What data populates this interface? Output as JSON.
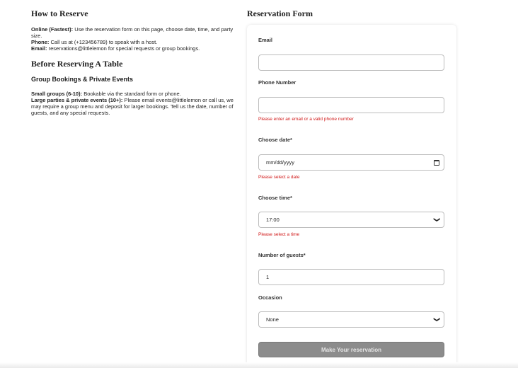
{
  "left": {
    "how_title": "How to Reserve",
    "online_label": "Online (Fastest):",
    "online_text": "Use the reservation form on this page, choose date, time, and party size.",
    "phone_label": "Phone:",
    "phone_text": "Call us at (+123456789) to speak with a host.",
    "email_label": "Email:",
    "email_text": "reservations@littlelemon for special requests or group bookings.",
    "before_title": "Before Reserving A Table",
    "group_title": "Group Bookings & Private Events",
    "small_label": "Small groups (6-10):",
    "small_text": "Bookable via the standard form or phone.",
    "large_label": "Large parties & private events (10+):",
    "large_text": "Please email events@littlelemon or call us, we may require a group menu and deposit for larger bookings. Tell us the date, number of guests, and any special requests."
  },
  "form": {
    "title": "Reservation Form",
    "email_label": "Email",
    "email_value": "",
    "phone_label": "Phone Number",
    "phone_value": "",
    "contact_error": "Please enter an email or a valid phone number",
    "date_label": "Choose date*",
    "date_placeholder": "mm/dd/yyyy",
    "date_error": "Please select a date",
    "time_label": "Choose time*",
    "time_value": "17:00",
    "time_error": "Please select a time",
    "guests_label": "Number of guests*",
    "guests_value": "1",
    "occasion_label": "Occasion",
    "occasion_value": "None",
    "submit_label": "Make Your reservation"
  },
  "icons": {
    "select_chevron": "chevron-down-icon",
    "date_picker": "calendar-icon"
  },
  "colors": {
    "error": "#d11a1a",
    "submit_disabled": "#8c8c8c"
  }
}
